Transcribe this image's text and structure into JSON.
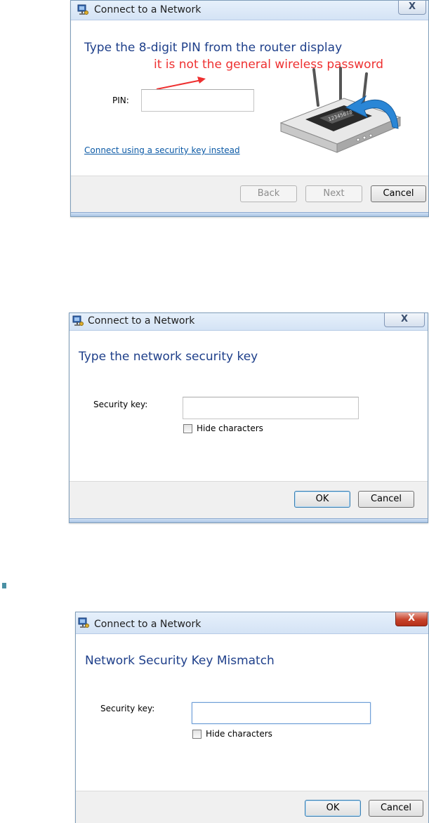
{
  "dialogs": [
    {
      "title": "Connect to a Network",
      "close": "X",
      "heading": "Type the 8-digit PIN from the router display",
      "annotation": "it is not the general wireless password",
      "pin_label": "PIN:",
      "pin_value": "",
      "link": "Connect using a security key instead",
      "router_display_text": "12345678",
      "buttons": {
        "back": "Back",
        "next": "Next",
        "cancel": "Cancel"
      }
    },
    {
      "title": "Connect to a Network",
      "close": "X",
      "heading": "Type the network security key",
      "key_label": "Security key:",
      "key_value": "",
      "checkbox_label": "Hide characters",
      "buttons": {
        "ok": "OK",
        "cancel": "Cancel"
      }
    },
    {
      "title": "Connect to a Network",
      "close": "X",
      "heading": "Network Security Key Mismatch",
      "key_label": "Security key:",
      "key_value": "",
      "checkbox_label": "Hide characters",
      "buttons": {
        "ok": "OK",
        "cancel": "Cancel"
      }
    }
  ],
  "colors": {
    "heading": "#1e3f8a",
    "annotation": "#ee3030",
    "link": "#0c5aa6",
    "close_red": "#c7432b"
  },
  "icons": [
    "network-icon",
    "close-icon",
    "router-illustration",
    "arrow-icon",
    "bookmark-icon"
  ]
}
